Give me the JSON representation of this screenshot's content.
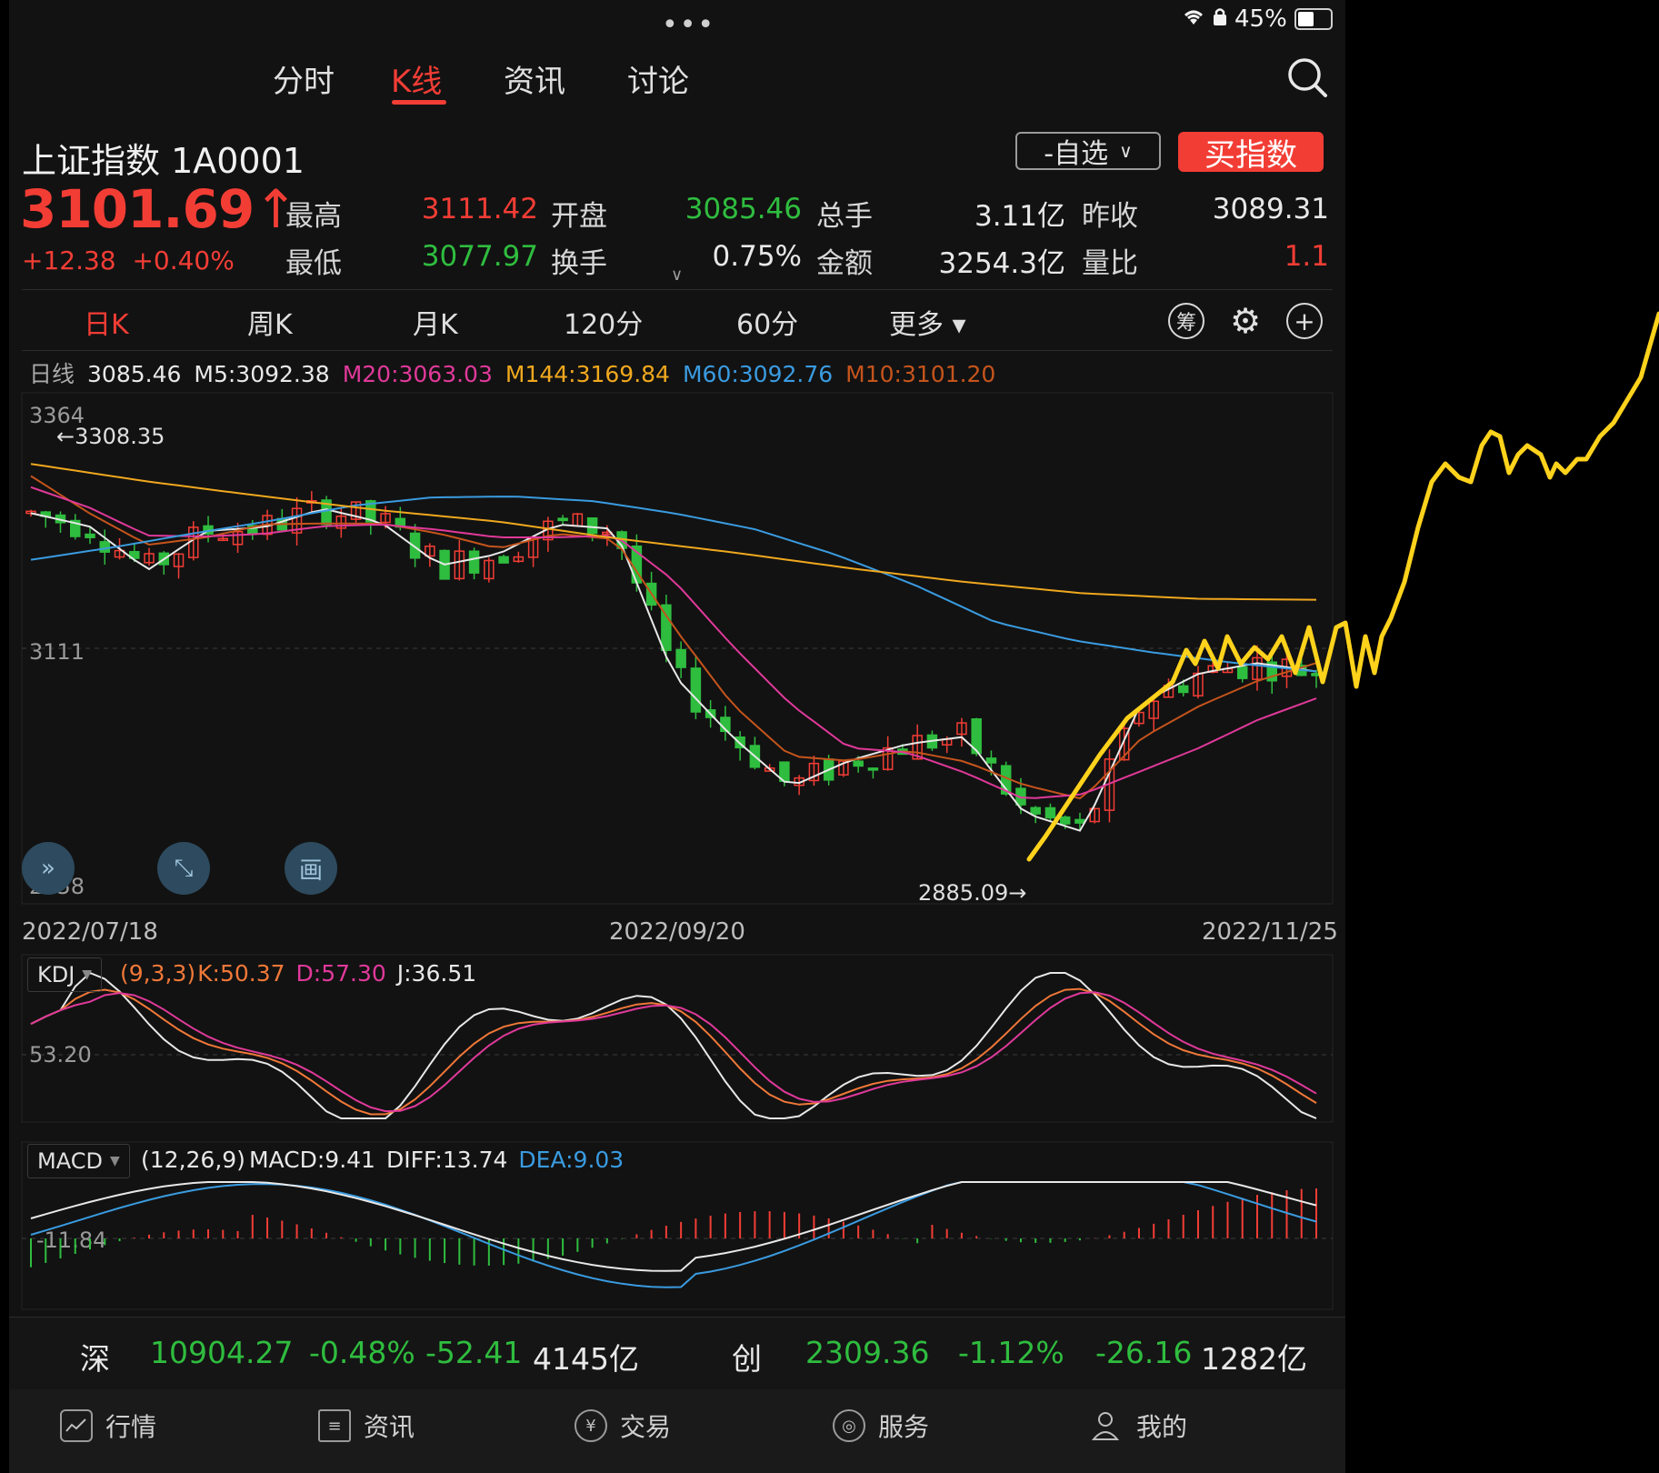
{
  "status": {
    "dots": "•••",
    "battery": "45%"
  },
  "tabs": [
    {
      "label": "分时"
    },
    {
      "label": "K线"
    },
    {
      "label": "资讯"
    },
    {
      "label": "讨论"
    }
  ],
  "header": {
    "name": "上证指数 1A0001",
    "watch_label": "-自选",
    "buy_label": "买指数",
    "price": "3101.69",
    "arrow": "↑",
    "change": "+12.38",
    "change_pct": "+0.40%"
  },
  "quote": {
    "high_label": "最高",
    "high": "3111.42",
    "open_label": "开盘",
    "open": "3085.46",
    "volume_label": "总手",
    "volume": "3.11亿",
    "prev_label": "昨收",
    "prev": "3089.31",
    "low_label": "最低",
    "low": "3077.97",
    "turnover_label": "换手",
    "turnover": "0.75%",
    "amount_label": "金额",
    "amount": "3254.3亿",
    "ratio_label": "量比",
    "ratio": "1.1"
  },
  "periods": [
    {
      "label": "日K"
    },
    {
      "label": "周K"
    },
    {
      "label": "月K"
    },
    {
      "label": "120分"
    },
    {
      "label": "60分"
    },
    {
      "label": "更多 ▾"
    }
  ],
  "period_icons": {
    "chip": "筹",
    "settings": "⚙",
    "zoom": "+"
  },
  "ma_legend": {
    "day": "日线",
    "close": "3085.46",
    "m5": "M5:3092.38",
    "m20": "M20:3063.03",
    "m144": "M144:3169.84",
    "m60": "M60:3092.76",
    "m10": "M10:3101.20"
  },
  "colors": {
    "up": "#f23d35",
    "down": "#2fbd3f",
    "m5": "#e8e8e8",
    "m20": "#e0399a",
    "m144": "#f0a81e",
    "m60": "#3a9be0",
    "m10": "#c5541c",
    "drawing": "#ffd21c"
  },
  "main_chart": {
    "axis_top": "3364",
    "axis_mid": "3111",
    "axis_bottom": "2858",
    "high_marker": "←3308.35",
    "low_marker": "2885.09→",
    "dates": [
      "2022/07/18",
      "2022/09/20",
      "2022/11/25"
    ]
  },
  "float_buttons": {
    "expand": "»",
    "fullscreen": "⤡",
    "draw": "画"
  },
  "kdj": {
    "name": "KDJ",
    "params": "(9,3,3)",
    "k": "K:50.37",
    "d": "D:57.30",
    "j": "J:36.51",
    "level": "53.20"
  },
  "macd": {
    "name": "MACD",
    "params": "(12,26,9)",
    "macd": "MACD:9.41",
    "diff": "DIFF:13.74",
    "dea": "DEA:9.03",
    "level": "-11.84"
  },
  "ticker": {
    "sz_label": "深",
    "sz_value": "10904.27",
    "sz_pct": "-0.48%",
    "sz_chg": "-52.41",
    "sz_amount": "4145亿",
    "cy_label": "创",
    "cy_value": "2309.36",
    "cy_pct": "-1.12%",
    "cy_chg": "-26.16",
    "cy_amount": "1282亿"
  },
  "nav": [
    {
      "label": "行情"
    },
    {
      "label": "资讯"
    },
    {
      "label": "交易"
    },
    {
      "label": "服务"
    },
    {
      "label": "我的"
    }
  ],
  "chart_data": {
    "type": "candlestick",
    "x_range": [
      "2022/07/18",
      "2022/11/25"
    ],
    "ylim": [
      2858,
      3364
    ],
    "annotations": {
      "high": 3308.35,
      "low": 2885.09
    },
    "ma_series": [
      {
        "name": "M5",
        "last": 3092.38,
        "anchors": [
          3262,
          3248,
          3201,
          3243,
          3247,
          3267,
          3252,
          3206,
          3218,
          3250,
          3245,
          3088,
          3022,
          2968,
          2996,
          3014,
          3022,
          2940,
          2920,
          3058,
          3090,
          3101,
          3092
        ]
      },
      {
        "name": "M10",
        "last": 3101.2,
        "anchors": [
          3302,
          3262,
          3228,
          3236,
          3250,
          3251,
          3251,
          3240,
          3224,
          3240,
          3234,
          3140,
          3057,
          3001,
          2996,
          3007,
          2995,
          2970,
          2955,
          3020,
          3055,
          3082,
          3101
        ]
      },
      {
        "name": "M20",
        "last": 3063.03,
        "anchors": [
          3290,
          3268,
          3238,
          3237,
          3240,
          3248,
          3250,
          3244,
          3236,
          3236,
          3238,
          3190,
          3120,
          3057,
          3010,
          3005,
          2983,
          2955,
          2960,
          2985,
          3010,
          3040,
          3063
        ]
      },
      {
        "name": "M60",
        "last": 3092.76,
        "anchors": [
          3212,
          3225,
          3240,
          3254,
          3270,
          3279,
          3280,
          3275,
          3262,
          3245,
          3218,
          3185,
          3145,
          3125,
          3112,
          3101,
          3092
        ]
      },
      {
        "name": "M144",
        "last": 3169.84,
        "anchors": [
          3315,
          3296,
          3280,
          3265,
          3253,
          3235,
          3220,
          3203,
          3188,
          3176,
          3170,
          3169
        ]
      }
    ],
    "kdj": {
      "level": 53.2,
      "k": 50.37,
      "d": 57.3,
      "j": 36.51
    },
    "macd": {
      "level": -11.84,
      "macd": 9.41,
      "diff": 13.74,
      "dea": 9.03
    }
  }
}
